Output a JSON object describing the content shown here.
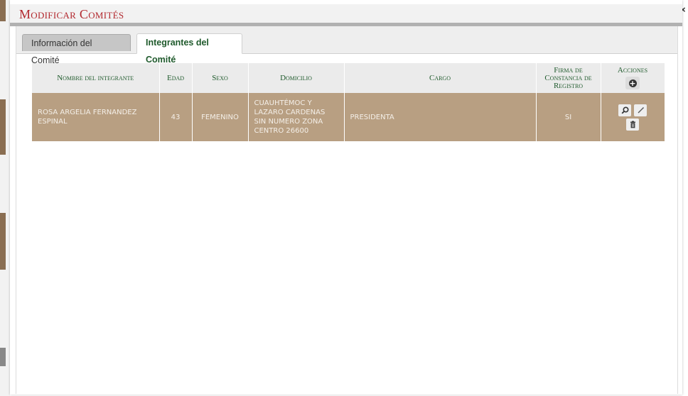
{
  "dialog": {
    "title": "Modificar Comités",
    "close_glyph": "×"
  },
  "tabs": [
    {
      "label": "Información del Comité",
      "active": false
    },
    {
      "label": "Integrantes del Comité",
      "active": true
    }
  ],
  "table": {
    "columns": {
      "nombre": "Nombre del integrante",
      "edad": "Edad",
      "sexo": "Sexo",
      "domicilio": "Domicilio",
      "cargo": "Cargo",
      "firma": "Firma de Constancia de Registro",
      "acciones": "Acciones"
    },
    "rows": [
      {
        "nombre": "ROSA ARGELIA  FERNANDEZ ESPINAL",
        "edad": "43",
        "sexo": "FEMENINO",
        "domicilio": "CUAUHTÉMOC Y LAZARO CARDENAS SIN NUMERO ZONA CENTRO 26600",
        "cargo": "PRESIDENTA",
        "firma": "SI"
      }
    ]
  },
  "icons": {
    "add": "plus-circle-icon",
    "view": "magnifier-icon",
    "edit": "pencil-icon",
    "delete": "trash-icon",
    "close": "close-icon"
  },
  "colors": {
    "title": "#b2282e",
    "header_text": "#1f5a2c",
    "row_background": "#b89f82",
    "row_text": "#f4efe8"
  }
}
